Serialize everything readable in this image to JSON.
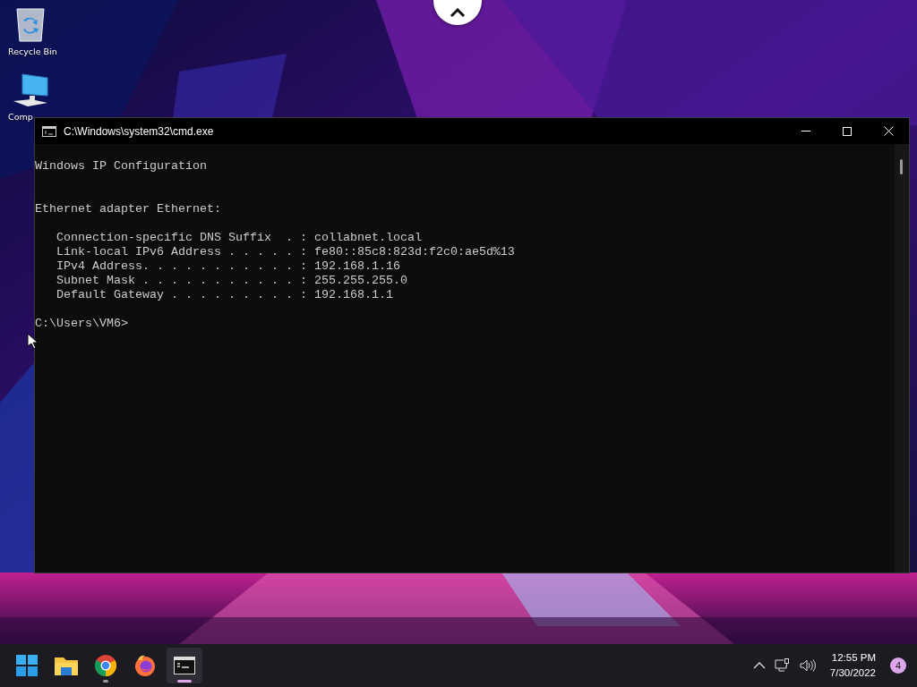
{
  "desktop_icons": [
    {
      "kind": "recycle-bin",
      "label": "Recycle Bin"
    },
    {
      "kind": "computer",
      "label": "Comp"
    }
  ],
  "window": {
    "title": "C:\\Windows\\system32\\cmd.exe",
    "console": {
      "heading": "Windows IP Configuration",
      "adapter": {
        "title": "Ethernet adapter Ethernet:",
        "entries": [
          "Connection-specific DNS Suffix  . : collabnet.local",
          "Link-local IPv6 Address . . . . . : fe80::85c8:823d:f2c0:ae5d%13",
          "IPv4 Address. . . . . . . . . . . : 192.168.1.16",
          "Subnet Mask . . . . . . . . . . . : 255.255.255.0",
          "Default Gateway . . . . . . . . . : 192.168.1.1"
        ]
      },
      "prompt": "C:\\Users\\VM6>"
    }
  },
  "taskbar": {
    "apps": [
      {
        "kind": "start",
        "running": false,
        "selected": false
      },
      {
        "kind": "files",
        "running": false,
        "selected": false
      },
      {
        "kind": "chrome",
        "running": true,
        "selected": false
      },
      {
        "kind": "firefox",
        "running": false,
        "selected": false
      },
      {
        "kind": "terminal",
        "running": true,
        "selected": true
      }
    ],
    "tray": {
      "time": "12:55 PM",
      "date": "7/30/2022",
      "notification_count": "4"
    }
  }
}
